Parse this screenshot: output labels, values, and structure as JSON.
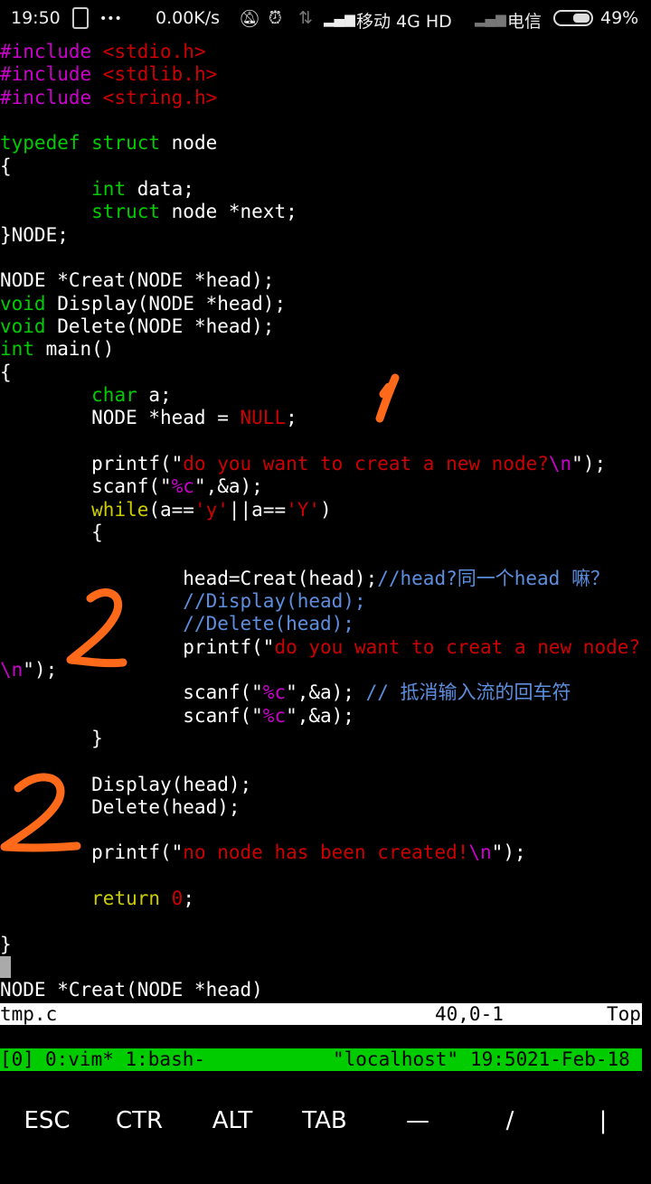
{
  "statusbar": {
    "time": "19:50",
    "more": "•••",
    "net_speed": "0.00K/s",
    "carrier1": "移动 4G HD",
    "carrier2": "电信",
    "battery": "49%",
    "battery_level": 49,
    "icons": [
      "sim-card-icon",
      "mute-bell-icon",
      "alarm-icon",
      "data-arrows-icon",
      "signal-icon",
      "signal-weak-icon",
      "battery-icon"
    ]
  },
  "editor": {
    "lines": [
      [
        [
          "p",
          "#include "
        ],
        [
          "s",
          "<stdio.h>"
        ]
      ],
      [
        [
          "p",
          "#include "
        ],
        [
          "s",
          "<stdlib.h>"
        ]
      ],
      [
        [
          "p",
          "#include "
        ],
        [
          "s",
          "<string.h>"
        ]
      ],
      [],
      [
        [
          "k",
          "typedef struct "
        ],
        [
          "n",
          "node"
        ]
      ],
      [
        [
          "n",
          "{"
        ]
      ],
      [
        [
          "n",
          "        "
        ],
        [
          "k",
          "int"
        ],
        [
          "n",
          " data;"
        ]
      ],
      [
        [
          "n",
          "        "
        ],
        [
          "k",
          "struct"
        ],
        [
          "n",
          " node *next;"
        ]
      ],
      [
        [
          "n",
          "}NODE;"
        ]
      ],
      [],
      [
        [
          "n",
          "NODE *Creat(NODE *head);"
        ]
      ],
      [
        [
          "k",
          "void"
        ],
        [
          "n",
          " Display(NODE *head);"
        ]
      ],
      [
        [
          "k",
          "void"
        ],
        [
          "n",
          " Delete(NODE *head);"
        ]
      ],
      [
        [
          "k",
          "int"
        ],
        [
          "n",
          " main()"
        ]
      ],
      [
        [
          "n",
          "{"
        ]
      ],
      [
        [
          "n",
          "        "
        ],
        [
          "k",
          "char"
        ],
        [
          "n",
          " a;"
        ]
      ],
      [
        [
          "n",
          "        NODE *head = "
        ],
        [
          "s",
          "NULL"
        ],
        [
          "n",
          ";"
        ]
      ],
      [],
      [
        [
          "n",
          "        printf(\""
        ],
        [
          "s",
          "do you want to creat a new node?"
        ],
        [
          "p",
          "\\n"
        ],
        [
          "n",
          "\");"
        ]
      ],
      [
        [
          "n",
          "        scanf(\""
        ],
        [
          "p",
          "%c"
        ],
        [
          "n",
          "\",&a);"
        ]
      ],
      [
        [
          "n",
          "        "
        ],
        [
          "y",
          "while"
        ],
        [
          "n",
          "(a=="
        ],
        [
          "s",
          "'y'"
        ],
        [
          "n",
          "||a=="
        ],
        [
          "s",
          "'Y'"
        ],
        [
          "n",
          ")"
        ]
      ],
      [
        [
          "n",
          "        {"
        ]
      ],
      [],
      [
        [
          "n",
          "                head=Creat(head);"
        ],
        [
          "c",
          "//head?同一个head 嘛？"
        ]
      ],
      [
        [
          "n",
          "                "
        ],
        [
          "c",
          "//Display(head);"
        ]
      ],
      [
        [
          "n",
          "                "
        ],
        [
          "c",
          "//Delete(head);"
        ]
      ],
      [
        [
          "n",
          "                printf(\""
        ],
        [
          "s",
          "do you want to creat a new node?"
        ]
      ],
      [
        [
          "p",
          "\\n"
        ],
        [
          "n",
          "\");"
        ]
      ],
      [
        [
          "n",
          "                scanf(\""
        ],
        [
          "p",
          "%c"
        ],
        [
          "n",
          "\",&a); "
        ],
        [
          "c",
          "// 抵消输入流的回车符"
        ]
      ],
      [
        [
          "n",
          "                scanf(\""
        ],
        [
          "p",
          "%c"
        ],
        [
          "n",
          "\",&a);"
        ]
      ],
      [
        [
          "n",
          "        }"
        ]
      ],
      [],
      [
        [
          "n",
          "        Display(head);"
        ]
      ],
      [
        [
          "n",
          "        Delete(head);"
        ]
      ],
      [],
      [
        [
          "n",
          "        printf(\""
        ],
        [
          "s",
          "no node has been created!"
        ],
        [
          "p",
          "\\n"
        ],
        [
          "n",
          "\");"
        ]
      ],
      [],
      [
        [
          "n",
          "        "
        ],
        [
          "y",
          "return"
        ],
        [
          "n",
          " "
        ],
        [
          "s",
          "0"
        ],
        [
          "n",
          ";"
        ]
      ],
      [],
      [
        [
          "n",
          "}"
        ]
      ],
      "cursor",
      [
        [
          "n",
          "NODE *Creat(NODE *head)"
        ]
      ]
    ],
    "colors": {
      "preproc": "#cc00cc",
      "string": "#cc0000",
      "keyword": "#00cc00",
      "comment": "#5c8fe0",
      "statement": "#cccc00",
      "normal": "#ffffff"
    }
  },
  "vim_status": {
    "filename": "tmp.c",
    "position": "40,0-1",
    "scroll": "Top"
  },
  "tmux": {
    "session": "[0]",
    "windows": "0:vim* 1:bash-",
    "host": "\"localhost\"",
    "time": "19:50",
    "date": "21-Feb-18",
    "color": "#00cc00"
  },
  "extra_keys": [
    "ESC",
    "CTR",
    "ALT",
    "TAB",
    "—",
    "/",
    "|"
  ],
  "annotations": {
    "color": "#ff6a1a",
    "marks": [
      "1",
      "2",
      "2"
    ]
  }
}
